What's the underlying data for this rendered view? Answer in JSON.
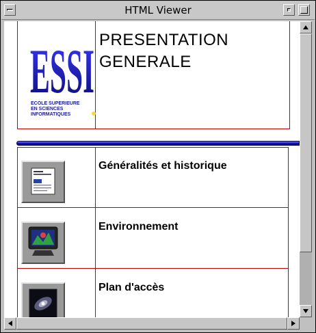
{
  "window": {
    "title": "HTML Viewer"
  },
  "header": {
    "title_line1": "PRESENTATION",
    "title_line2": "GENERALE",
    "logo": {
      "letters": "ESSI",
      "line1": "ECOLE SUPERIEURE",
      "line2": "EN SCIENCES",
      "line3": "INFORMATIQUES"
    }
  },
  "items": [
    {
      "label": "Généralités et historique",
      "icon": "document-icon"
    },
    {
      "label": "Environnement",
      "icon": "monitor-icon"
    },
    {
      "label": "Plan d'accès",
      "icon": "galaxy-icon"
    }
  ],
  "colors": {
    "table_border": "#c00000",
    "logo_blue": "#1a1a9a",
    "bar_blue": "#1818c8"
  }
}
